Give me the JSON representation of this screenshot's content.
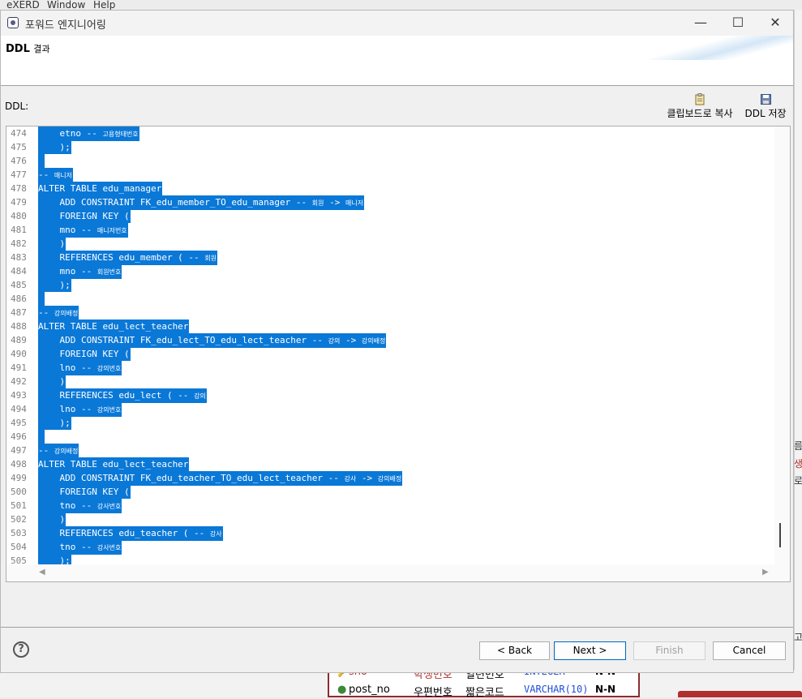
{
  "background": {
    "menu": [
      "eXERD",
      "Window",
      "Help"
    ],
    "right_glyphs": [
      "름",
      "생",
      "로",
      "고"
    ],
    "entity_rows": [
      {
        "icon": "key",
        "name": "sno",
        "logical": "학생번호",
        "domain": "일련번호",
        "type": "INTEGER",
        "null": "N-N"
      },
      {
        "icon": "dot",
        "name": "post_no",
        "logical": "우편번호",
        "domain": "짧은코드",
        "type": "VARCHAR(10)",
        "null": "N-N"
      }
    ]
  },
  "dialog": {
    "title": "포워드 엔지니어링",
    "header_title": "DDL",
    "header_subtitle": "결과",
    "ddl_label": "DDL:",
    "toolbar": {
      "copy_label": "클립보드로 복사",
      "save_label": "DDL 저장"
    },
    "code_lines": [
      {
        "n": "474",
        "segs": [
          {
            "t": "    etno -- "
          },
          {
            "t": "고용형태번호",
            "k": 1
          }
        ]
      },
      {
        "n": "475",
        "segs": [
          {
            "t": "    );"
          }
        ]
      },
      {
        "n": "476",
        "segs": [
          {
            "t": " "
          }
        ]
      },
      {
        "n": "477",
        "segs": [
          {
            "t": "-- "
          },
          {
            "t": "매니저",
            "k": 1
          }
        ]
      },
      {
        "n": "478",
        "segs": [
          {
            "t": "ALTER TABLE edu_manager"
          }
        ]
      },
      {
        "n": "479",
        "segs": [
          {
            "t": "    ADD CONSTRAINT FK_edu_member_TO_edu_manager -- "
          },
          {
            "t": "회원",
            "k": 1
          },
          {
            "t": " -> "
          },
          {
            "t": "매니저",
            "k": 1
          }
        ]
      },
      {
        "n": "480",
        "segs": [
          {
            "t": "    FOREIGN KEY ("
          }
        ]
      },
      {
        "n": "481",
        "segs": [
          {
            "t": "    mno -- "
          },
          {
            "t": "매니저번호",
            "k": 1
          }
        ]
      },
      {
        "n": "482",
        "segs": [
          {
            "t": "    )"
          }
        ]
      },
      {
        "n": "483",
        "segs": [
          {
            "t": "    REFERENCES edu_member ( -- "
          },
          {
            "t": "회원",
            "k": 1
          }
        ]
      },
      {
        "n": "484",
        "segs": [
          {
            "t": "    mno -- "
          },
          {
            "t": "회원번호",
            "k": 1
          }
        ]
      },
      {
        "n": "485",
        "segs": [
          {
            "t": "    );"
          }
        ]
      },
      {
        "n": "486",
        "segs": [
          {
            "t": " "
          }
        ]
      },
      {
        "n": "487",
        "segs": [
          {
            "t": "-- "
          },
          {
            "t": "강의배정",
            "k": 1
          }
        ]
      },
      {
        "n": "488",
        "segs": [
          {
            "t": "ALTER TABLE edu_lect_teacher"
          }
        ]
      },
      {
        "n": "489",
        "segs": [
          {
            "t": "    ADD CONSTRAINT FK_edu_lect_TO_edu_lect_teacher -- "
          },
          {
            "t": "강의",
            "k": 1
          },
          {
            "t": " -> "
          },
          {
            "t": "강의배정",
            "k": 1
          }
        ]
      },
      {
        "n": "490",
        "segs": [
          {
            "t": "    FOREIGN KEY ("
          }
        ]
      },
      {
        "n": "491",
        "segs": [
          {
            "t": "    lno -- "
          },
          {
            "t": "강의번호",
            "k": 1
          }
        ]
      },
      {
        "n": "492",
        "segs": [
          {
            "t": "    )"
          }
        ]
      },
      {
        "n": "493",
        "segs": [
          {
            "t": "    REFERENCES edu_lect ( -- "
          },
          {
            "t": "강의",
            "k": 1
          }
        ]
      },
      {
        "n": "494",
        "segs": [
          {
            "t": "    lno -- "
          },
          {
            "t": "강의번호",
            "k": 1
          }
        ]
      },
      {
        "n": "495",
        "segs": [
          {
            "t": "    );"
          }
        ]
      },
      {
        "n": "496",
        "segs": [
          {
            "t": " "
          }
        ]
      },
      {
        "n": "497",
        "segs": [
          {
            "t": "-- "
          },
          {
            "t": "강의배정",
            "k": 1
          }
        ]
      },
      {
        "n": "498",
        "segs": [
          {
            "t": "ALTER TABLE edu_lect_teacher"
          }
        ]
      },
      {
        "n": "499",
        "segs": [
          {
            "t": "    ADD CONSTRAINT FK_edu_teacher_TO_edu_lect_teacher -- "
          },
          {
            "t": "강사",
            "k": 1
          },
          {
            "t": " -> "
          },
          {
            "t": "강의배정",
            "k": 1
          }
        ]
      },
      {
        "n": "500",
        "segs": [
          {
            "t": "    FOREIGN KEY ("
          }
        ]
      },
      {
        "n": "501",
        "segs": [
          {
            "t": "    tno -- "
          },
          {
            "t": "강사번호",
            "k": 1
          }
        ]
      },
      {
        "n": "502",
        "segs": [
          {
            "t": "    )"
          }
        ]
      },
      {
        "n": "503",
        "segs": [
          {
            "t": "    REFERENCES edu_teacher ( -- "
          },
          {
            "t": "강사",
            "k": 1
          }
        ]
      },
      {
        "n": "504",
        "segs": [
          {
            "t": "    tno -- "
          },
          {
            "t": "강사번호",
            "k": 1
          }
        ]
      },
      {
        "n": "505",
        "segs": [
          {
            "t": "    );"
          }
        ]
      }
    ],
    "buttons": {
      "back": "< Back",
      "next": "Next >",
      "finish": "Finish",
      "cancel": "Cancel"
    },
    "help_glyph": "?"
  },
  "colors": {
    "selection": "#0a78d7",
    "entity_border": "#8b2e2e",
    "key_text": "#b03030",
    "type_text": "#1f4fd8"
  }
}
